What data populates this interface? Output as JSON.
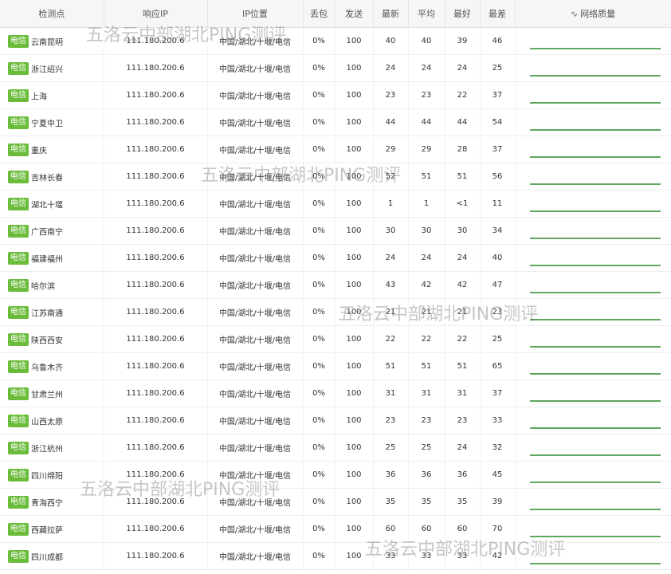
{
  "columns": {
    "node": "检测点",
    "ip": "响应IP",
    "location": "IP位置",
    "loss": "丢包",
    "sent": "发送",
    "latest": "最新",
    "avg": "平均",
    "best": "最好",
    "worst": "最差",
    "quality": "网络质量"
  },
  "quality_icon": "pulse-icon",
  "colors": {
    "isp_badge": "#6cbc3c",
    "quality_line": "#2b8a2b"
  },
  "watermark_text": "五洛云中部湖北PING测评",
  "rows": [
    {
      "isp": "电信",
      "city": "云南昆明",
      "ip": "111.180.200.6",
      "location": "中国/湖北/十堰/电信",
      "loss": "0%",
      "sent": "100",
      "latest": "40",
      "avg": "40",
      "best": "39",
      "worst": "46"
    },
    {
      "isp": "电信",
      "city": "浙江绍兴",
      "ip": "111.180.200.6",
      "location": "中国/湖北/十堰/电信",
      "loss": "0%",
      "sent": "100",
      "latest": "24",
      "avg": "24",
      "best": "24",
      "worst": "25"
    },
    {
      "isp": "电信",
      "city": "上海",
      "ip": "111.180.200.6",
      "location": "中国/湖北/十堰/电信",
      "loss": "0%",
      "sent": "100",
      "latest": "23",
      "avg": "23",
      "best": "22",
      "worst": "37"
    },
    {
      "isp": "电信",
      "city": "宁夏中卫",
      "ip": "111.180.200.6",
      "location": "中国/湖北/十堰/电信",
      "loss": "0%",
      "sent": "100",
      "latest": "44",
      "avg": "44",
      "best": "44",
      "worst": "54"
    },
    {
      "isp": "电信",
      "city": "重庆",
      "ip": "111.180.200.6",
      "location": "中国/湖北/十堰/电信",
      "loss": "0%",
      "sent": "100",
      "latest": "29",
      "avg": "29",
      "best": "28",
      "worst": "37"
    },
    {
      "isp": "电信",
      "city": "吉林长春",
      "ip": "111.180.200.6",
      "location": "中国/湖北/十堰/电信",
      "loss": "0%",
      "sent": "100",
      "latest": "52",
      "avg": "51",
      "best": "51",
      "worst": "56"
    },
    {
      "isp": "电信",
      "city": "湖北十堰",
      "ip": "111.180.200.6",
      "location": "中国/湖北/十堰/电信",
      "loss": "0%",
      "sent": "100",
      "latest": "1",
      "avg": "1",
      "best": "<1",
      "worst": "11"
    },
    {
      "isp": "电信",
      "city": "广西南宁",
      "ip": "111.180.200.6",
      "location": "中国/湖北/十堰/电信",
      "loss": "0%",
      "sent": "100",
      "latest": "30",
      "avg": "30",
      "best": "30",
      "worst": "34"
    },
    {
      "isp": "电信",
      "city": "福建福州",
      "ip": "111.180.200.6",
      "location": "中国/湖北/十堰/电信",
      "loss": "0%",
      "sent": "100",
      "latest": "24",
      "avg": "24",
      "best": "24",
      "worst": "40"
    },
    {
      "isp": "电信",
      "city": "哈尔滨",
      "ip": "111.180.200.6",
      "location": "中国/湖北/十堰/电信",
      "loss": "0%",
      "sent": "100",
      "latest": "43",
      "avg": "42",
      "best": "42",
      "worst": "47"
    },
    {
      "isp": "电信",
      "city": "江苏南通",
      "ip": "111.180.200.6",
      "location": "中国/湖北/十堰/电信",
      "loss": "0%",
      "sent": "100",
      "latest": "21",
      "avg": "21",
      "best": "21",
      "worst": "23"
    },
    {
      "isp": "电信",
      "city": "陕西西安",
      "ip": "111.180.200.6",
      "location": "中国/湖北/十堰/电信",
      "loss": "0%",
      "sent": "100",
      "latest": "22",
      "avg": "22",
      "best": "22",
      "worst": "25"
    },
    {
      "isp": "电信",
      "city": "乌鲁木齐",
      "ip": "111.180.200.6",
      "location": "中国/湖北/十堰/电信",
      "loss": "0%",
      "sent": "100",
      "latest": "51",
      "avg": "51",
      "best": "51",
      "worst": "65"
    },
    {
      "isp": "电信",
      "city": "甘肃兰州",
      "ip": "111.180.200.6",
      "location": "中国/湖北/十堰/电信",
      "loss": "0%",
      "sent": "100",
      "latest": "31",
      "avg": "31",
      "best": "31",
      "worst": "37"
    },
    {
      "isp": "电信",
      "city": "山西太原",
      "ip": "111.180.200.6",
      "location": "中国/湖北/十堰/电信",
      "loss": "0%",
      "sent": "100",
      "latest": "23",
      "avg": "23",
      "best": "23",
      "worst": "33"
    },
    {
      "isp": "电信",
      "city": "浙江杭州",
      "ip": "111.180.200.6",
      "location": "中国/湖北/十堰/电信",
      "loss": "0%",
      "sent": "100",
      "latest": "25",
      "avg": "25",
      "best": "24",
      "worst": "32"
    },
    {
      "isp": "电信",
      "city": "四川绵阳",
      "ip": "111.180.200.6",
      "location": "中国/湖北/十堰/电信",
      "loss": "0%",
      "sent": "100",
      "latest": "36",
      "avg": "36",
      "best": "36",
      "worst": "45"
    },
    {
      "isp": "电信",
      "city": "青海西宁",
      "ip": "111.180.200.6",
      "location": "中国/湖北/十堰/电信",
      "loss": "0%",
      "sent": "100",
      "latest": "35",
      "avg": "35",
      "best": "35",
      "worst": "39"
    },
    {
      "isp": "电信",
      "city": "西藏拉萨",
      "ip": "111.180.200.6",
      "location": "中国/湖北/十堰/电信",
      "loss": "0%",
      "sent": "100",
      "latest": "60",
      "avg": "60",
      "best": "60",
      "worst": "70"
    },
    {
      "isp": "电信",
      "city": "四川成都",
      "ip": "111.180.200.6",
      "location": "中国/湖北/十堰/电信",
      "loss": "0%",
      "sent": "100",
      "latest": "33",
      "avg": "33",
      "best": "33",
      "worst": "42"
    }
  ]
}
